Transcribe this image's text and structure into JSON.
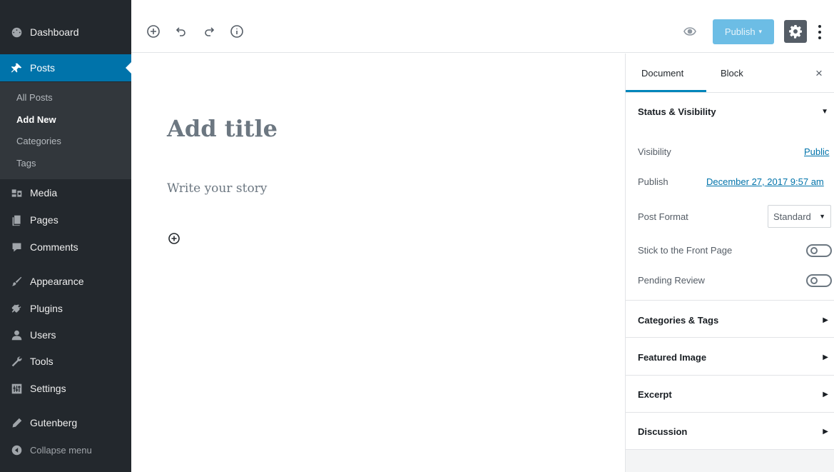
{
  "admin_menu": {
    "dashboard": "Dashboard",
    "posts": "Posts",
    "posts_submenu": [
      "All Posts",
      "Add New",
      "Categories",
      "Tags"
    ],
    "media": "Media",
    "pages": "Pages",
    "comments": "Comments",
    "appearance": "Appearance",
    "plugins": "Plugins",
    "users": "Users",
    "tools": "Tools",
    "settings": "Settings",
    "gutenberg": "Gutenberg",
    "collapse": "Collapse menu",
    "current_item": "Posts",
    "current_subitem": "Add New",
    "colors": {
      "bg": "#23282d",
      "submenu_bg": "#32373c",
      "accent": "#0073aa"
    }
  },
  "toolbar": {
    "icons": [
      "add-block-icon",
      "undo-icon",
      "redo-icon",
      "info-icon",
      "preview-eye-icon",
      "gear-icon",
      "more-vertical-icon"
    ],
    "publish_label": "Publish",
    "publish_caret": "▾",
    "publish_color": "#6cbde5"
  },
  "editor": {
    "title_placeholder": "Add title",
    "body_placeholder": "Write your story"
  },
  "settings_panel": {
    "tabs": [
      "Document",
      "Block"
    ],
    "active_tab": "Document",
    "close_glyph": "×",
    "status_visibility": {
      "title": "Status & Visibility",
      "expanded": true,
      "visibility_label": "Visibility",
      "visibility_value": "Public",
      "publish_label": "Publish",
      "publish_value": "December 27, 2017 9:57 am",
      "post_format_label": "Post Format",
      "post_format_value": "Standard",
      "sticky_label": "Stick to the Front Page",
      "sticky_on": false,
      "pending_label": "Pending Review",
      "pending_on": false
    },
    "collapsed_sections": [
      "Categories & Tags",
      "Featured Image",
      "Excerpt",
      "Discussion"
    ],
    "arrow_expanded": "▼",
    "arrow_collapsed": "▶"
  }
}
